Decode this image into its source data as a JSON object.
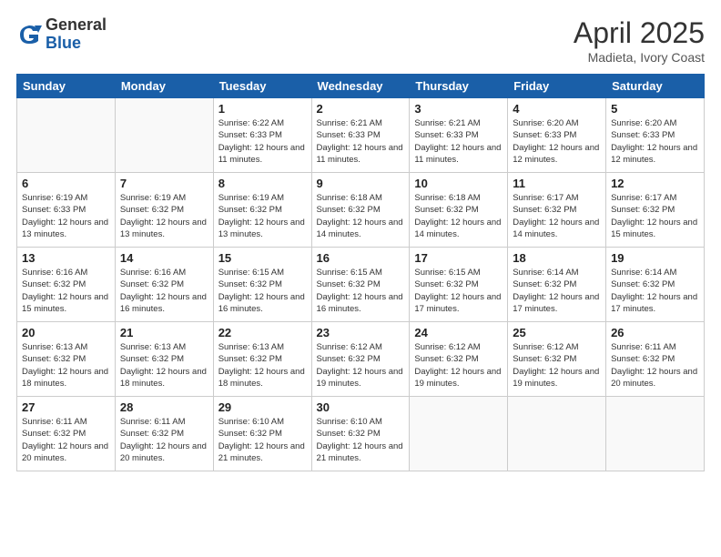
{
  "logo": {
    "general": "General",
    "blue": "Blue"
  },
  "header": {
    "month": "April 2025",
    "location": "Madieta, Ivory Coast"
  },
  "weekdays": [
    "Sunday",
    "Monday",
    "Tuesday",
    "Wednesday",
    "Thursday",
    "Friday",
    "Saturday"
  ],
  "weeks": [
    [
      {
        "day": "",
        "info": ""
      },
      {
        "day": "",
        "info": ""
      },
      {
        "day": "1",
        "info": "Sunrise: 6:22 AM\nSunset: 6:33 PM\nDaylight: 12 hours and 11 minutes."
      },
      {
        "day": "2",
        "info": "Sunrise: 6:21 AM\nSunset: 6:33 PM\nDaylight: 12 hours and 11 minutes."
      },
      {
        "day": "3",
        "info": "Sunrise: 6:21 AM\nSunset: 6:33 PM\nDaylight: 12 hours and 11 minutes."
      },
      {
        "day": "4",
        "info": "Sunrise: 6:20 AM\nSunset: 6:33 PM\nDaylight: 12 hours and 12 minutes."
      },
      {
        "day": "5",
        "info": "Sunrise: 6:20 AM\nSunset: 6:33 PM\nDaylight: 12 hours and 12 minutes."
      }
    ],
    [
      {
        "day": "6",
        "info": "Sunrise: 6:19 AM\nSunset: 6:33 PM\nDaylight: 12 hours and 13 minutes."
      },
      {
        "day": "7",
        "info": "Sunrise: 6:19 AM\nSunset: 6:32 PM\nDaylight: 12 hours and 13 minutes."
      },
      {
        "day": "8",
        "info": "Sunrise: 6:19 AM\nSunset: 6:32 PM\nDaylight: 12 hours and 13 minutes."
      },
      {
        "day": "9",
        "info": "Sunrise: 6:18 AM\nSunset: 6:32 PM\nDaylight: 12 hours and 14 minutes."
      },
      {
        "day": "10",
        "info": "Sunrise: 6:18 AM\nSunset: 6:32 PM\nDaylight: 12 hours and 14 minutes."
      },
      {
        "day": "11",
        "info": "Sunrise: 6:17 AM\nSunset: 6:32 PM\nDaylight: 12 hours and 14 minutes."
      },
      {
        "day": "12",
        "info": "Sunrise: 6:17 AM\nSunset: 6:32 PM\nDaylight: 12 hours and 15 minutes."
      }
    ],
    [
      {
        "day": "13",
        "info": "Sunrise: 6:16 AM\nSunset: 6:32 PM\nDaylight: 12 hours and 15 minutes."
      },
      {
        "day": "14",
        "info": "Sunrise: 6:16 AM\nSunset: 6:32 PM\nDaylight: 12 hours and 16 minutes."
      },
      {
        "day": "15",
        "info": "Sunrise: 6:15 AM\nSunset: 6:32 PM\nDaylight: 12 hours and 16 minutes."
      },
      {
        "day": "16",
        "info": "Sunrise: 6:15 AM\nSunset: 6:32 PM\nDaylight: 12 hours and 16 minutes."
      },
      {
        "day": "17",
        "info": "Sunrise: 6:15 AM\nSunset: 6:32 PM\nDaylight: 12 hours and 17 minutes."
      },
      {
        "day": "18",
        "info": "Sunrise: 6:14 AM\nSunset: 6:32 PM\nDaylight: 12 hours and 17 minutes."
      },
      {
        "day": "19",
        "info": "Sunrise: 6:14 AM\nSunset: 6:32 PM\nDaylight: 12 hours and 17 minutes."
      }
    ],
    [
      {
        "day": "20",
        "info": "Sunrise: 6:13 AM\nSunset: 6:32 PM\nDaylight: 12 hours and 18 minutes."
      },
      {
        "day": "21",
        "info": "Sunrise: 6:13 AM\nSunset: 6:32 PM\nDaylight: 12 hours and 18 minutes."
      },
      {
        "day": "22",
        "info": "Sunrise: 6:13 AM\nSunset: 6:32 PM\nDaylight: 12 hours and 18 minutes."
      },
      {
        "day": "23",
        "info": "Sunrise: 6:12 AM\nSunset: 6:32 PM\nDaylight: 12 hours and 19 minutes."
      },
      {
        "day": "24",
        "info": "Sunrise: 6:12 AM\nSunset: 6:32 PM\nDaylight: 12 hours and 19 minutes."
      },
      {
        "day": "25",
        "info": "Sunrise: 6:12 AM\nSunset: 6:32 PM\nDaylight: 12 hours and 19 minutes."
      },
      {
        "day": "26",
        "info": "Sunrise: 6:11 AM\nSunset: 6:32 PM\nDaylight: 12 hours and 20 minutes."
      }
    ],
    [
      {
        "day": "27",
        "info": "Sunrise: 6:11 AM\nSunset: 6:32 PM\nDaylight: 12 hours and 20 minutes."
      },
      {
        "day": "28",
        "info": "Sunrise: 6:11 AM\nSunset: 6:32 PM\nDaylight: 12 hours and 20 minutes."
      },
      {
        "day": "29",
        "info": "Sunrise: 6:10 AM\nSunset: 6:32 PM\nDaylight: 12 hours and 21 minutes."
      },
      {
        "day": "30",
        "info": "Sunrise: 6:10 AM\nSunset: 6:32 PM\nDaylight: 12 hours and 21 minutes."
      },
      {
        "day": "",
        "info": ""
      },
      {
        "day": "",
        "info": ""
      },
      {
        "day": "",
        "info": ""
      }
    ]
  ]
}
